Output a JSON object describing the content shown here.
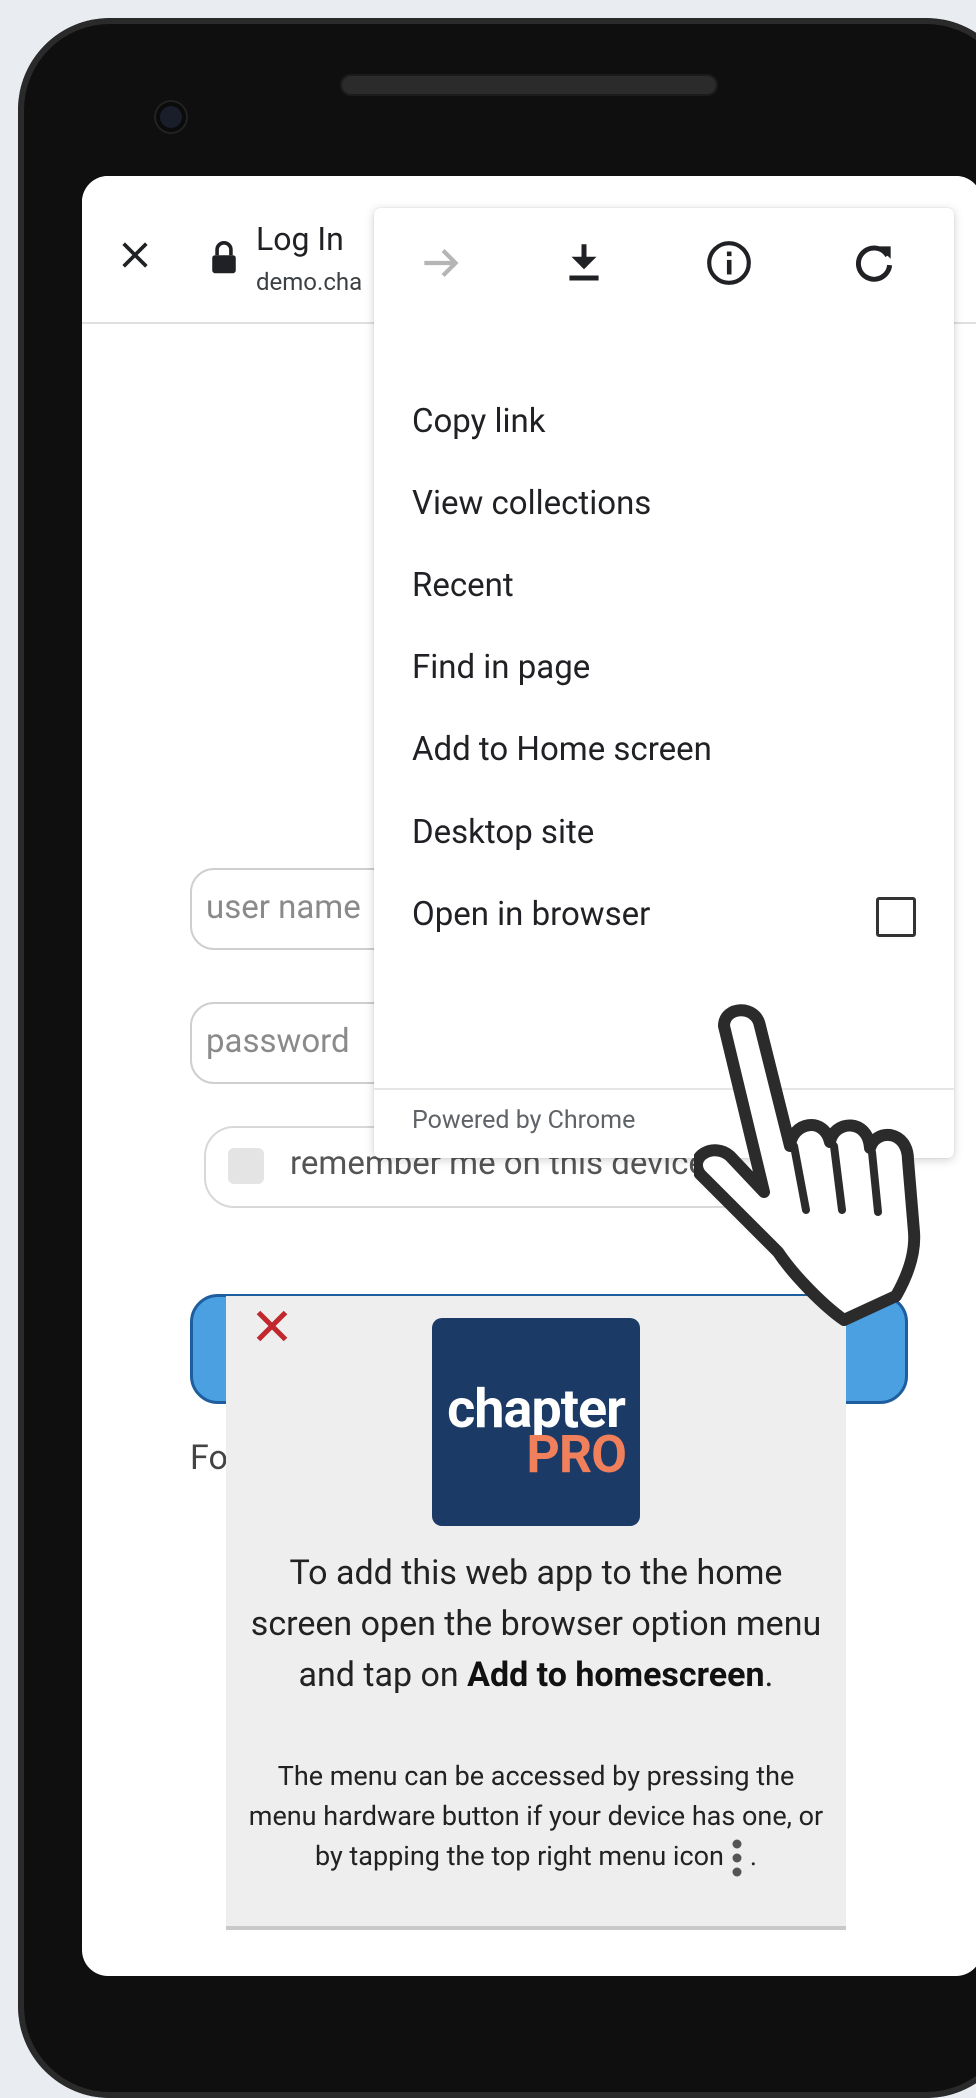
{
  "browser": {
    "title": "Log In",
    "url": "demo.cha"
  },
  "login": {
    "username_placeholder": "user name",
    "password_placeholder": "password",
    "remember_label": "remember me on this device",
    "forgot_partial": "Fo"
  },
  "menu": {
    "items": [
      "Copy link",
      "View collections",
      "Recent",
      "Find in page",
      "Add to Home screen",
      "Desktop site",
      "Open in browser"
    ],
    "footer": "Powered by Chrome"
  },
  "popup": {
    "logo_line1": "chapter",
    "logo_line2": "PRO",
    "main_text_1": "To add this web app to the home screen open the browser option menu and tap on ",
    "main_bold": "Add to homescreen",
    "main_text_2": ".",
    "sub_text_1": "The menu can be accessed by pressing the menu hardware button if your device has one, or by tapping the top right menu icon",
    "sub_text_2": "."
  },
  "colors": {
    "logo_bg": "#1b3a66",
    "logo_accent": "#f07f5b",
    "button_blue": "#4aa0e0",
    "close_red": "#c0282d"
  }
}
